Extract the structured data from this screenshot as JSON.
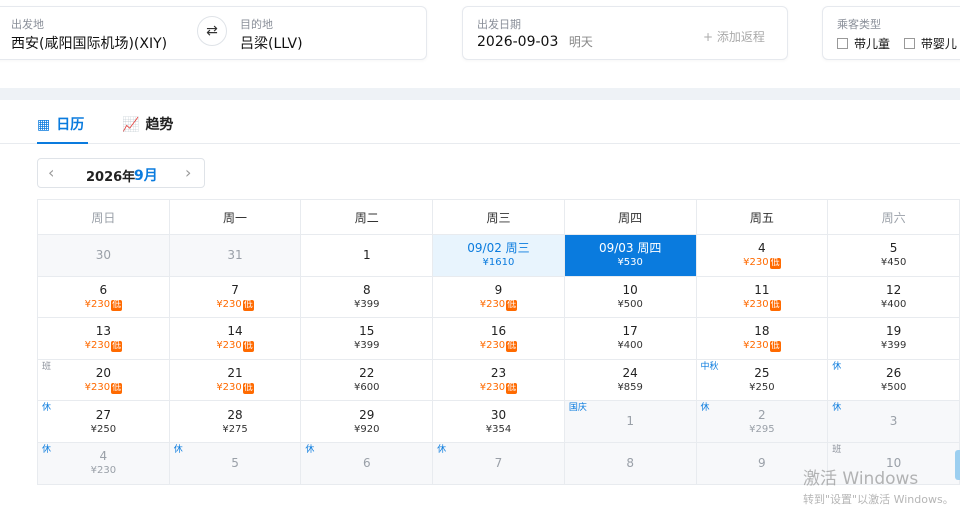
{
  "search": {
    "from_label": "出发地",
    "from_value": "西安(咸阳国际机场)(XIY)",
    "to_label": "目的地",
    "to_value": "吕梁(LLV)",
    "date_label": "出发日期",
    "date_value": "2026-09-03",
    "date_hint": "明天",
    "add_return": "+ 添加返程",
    "passenger_label": "乘客类型",
    "child_label": "带儿童",
    "infant_label": "带婴儿"
  },
  "tabs": [
    {
      "label": "日历",
      "icon": "calendar-icon",
      "active": true
    },
    {
      "label": "趋势",
      "icon": "trend-icon",
      "active": false
    }
  ],
  "month_nav": {
    "year": "2026年",
    "month": "9月"
  },
  "weekdays": [
    "周日",
    "周一",
    "周二",
    "周三",
    "周四",
    "周五",
    "周六"
  ],
  "calendar": [
    [
      {
        "d": "30",
        "state": "dim"
      },
      {
        "d": "31",
        "state": "dim"
      },
      {
        "d": "1"
      },
      {
        "d": "09/02 周三",
        "p": "¥1610",
        "state": "today"
      },
      {
        "d": "09/03 周四",
        "p": "¥530",
        "state": "sel"
      },
      {
        "d": "4",
        "p": "¥230",
        "low": true
      },
      {
        "d": "5",
        "p": "¥450"
      }
    ],
    [
      {
        "d": "6",
        "p": "¥230",
        "low": true
      },
      {
        "d": "7",
        "p": "¥230",
        "low": true
      },
      {
        "d": "8",
        "p": "¥399"
      },
      {
        "d": "9",
        "p": "¥230",
        "low": true
      },
      {
        "d": "10",
        "p": "¥500"
      },
      {
        "d": "11",
        "p": "¥230",
        "low": true
      },
      {
        "d": "12",
        "p": "¥400"
      }
    ],
    [
      {
        "d": "13",
        "p": "¥230",
        "low": true
      },
      {
        "d": "14",
        "p": "¥230",
        "low": true
      },
      {
        "d": "15",
        "p": "¥399"
      },
      {
        "d": "16",
        "p": "¥230",
        "low": true
      },
      {
        "d": "17",
        "p": "¥400"
      },
      {
        "d": "18",
        "p": "¥230",
        "low": true
      },
      {
        "d": "19",
        "p": "¥399"
      }
    ],
    [
      {
        "d": "20",
        "p": "¥230",
        "low": true,
        "tag": "班",
        "tagtype": "ban"
      },
      {
        "d": "21",
        "p": "¥230",
        "low": true
      },
      {
        "d": "22",
        "p": "¥600"
      },
      {
        "d": "23",
        "p": "¥230",
        "low": true
      },
      {
        "d": "24",
        "p": "¥859"
      },
      {
        "d": "25",
        "p": "¥250",
        "tag": "中秋"
      },
      {
        "d": "26",
        "p": "¥500",
        "tag": "休"
      }
    ],
    [
      {
        "d": "27",
        "p": "¥250",
        "tag": "休"
      },
      {
        "d": "28",
        "p": "¥275"
      },
      {
        "d": "29",
        "p": "¥920"
      },
      {
        "d": "30",
        "p": "¥354"
      },
      {
        "d": "1",
        "state": "dim",
        "tag": "国庆"
      },
      {
        "d": "2",
        "p": "¥295",
        "state": "dim",
        "tag": "休"
      },
      {
        "d": "3",
        "state": "dim",
        "tag": "休"
      }
    ],
    [
      {
        "d": "4",
        "p": "¥230",
        "state": "dim",
        "tag": "休"
      },
      {
        "d": "5",
        "state": "dim",
        "tag": "休"
      },
      {
        "d": "6",
        "state": "dim",
        "tag": "休"
      },
      {
        "d": "7",
        "state": "dim",
        "tag": "休"
      },
      {
        "d": "8",
        "state": "dim"
      },
      {
        "d": "9",
        "state": "dim"
      },
      {
        "d": "10",
        "state": "dim",
        "tag": "班",
        "tagtype": "ban"
      }
    ]
  ],
  "low_badge": "低",
  "watermark": {
    "line1": "激活 Windows",
    "line2": "转到\"设置\"以激活 Windows。"
  },
  "colors": {
    "accent": "#0a7bde",
    "low": "#ff6a00"
  }
}
